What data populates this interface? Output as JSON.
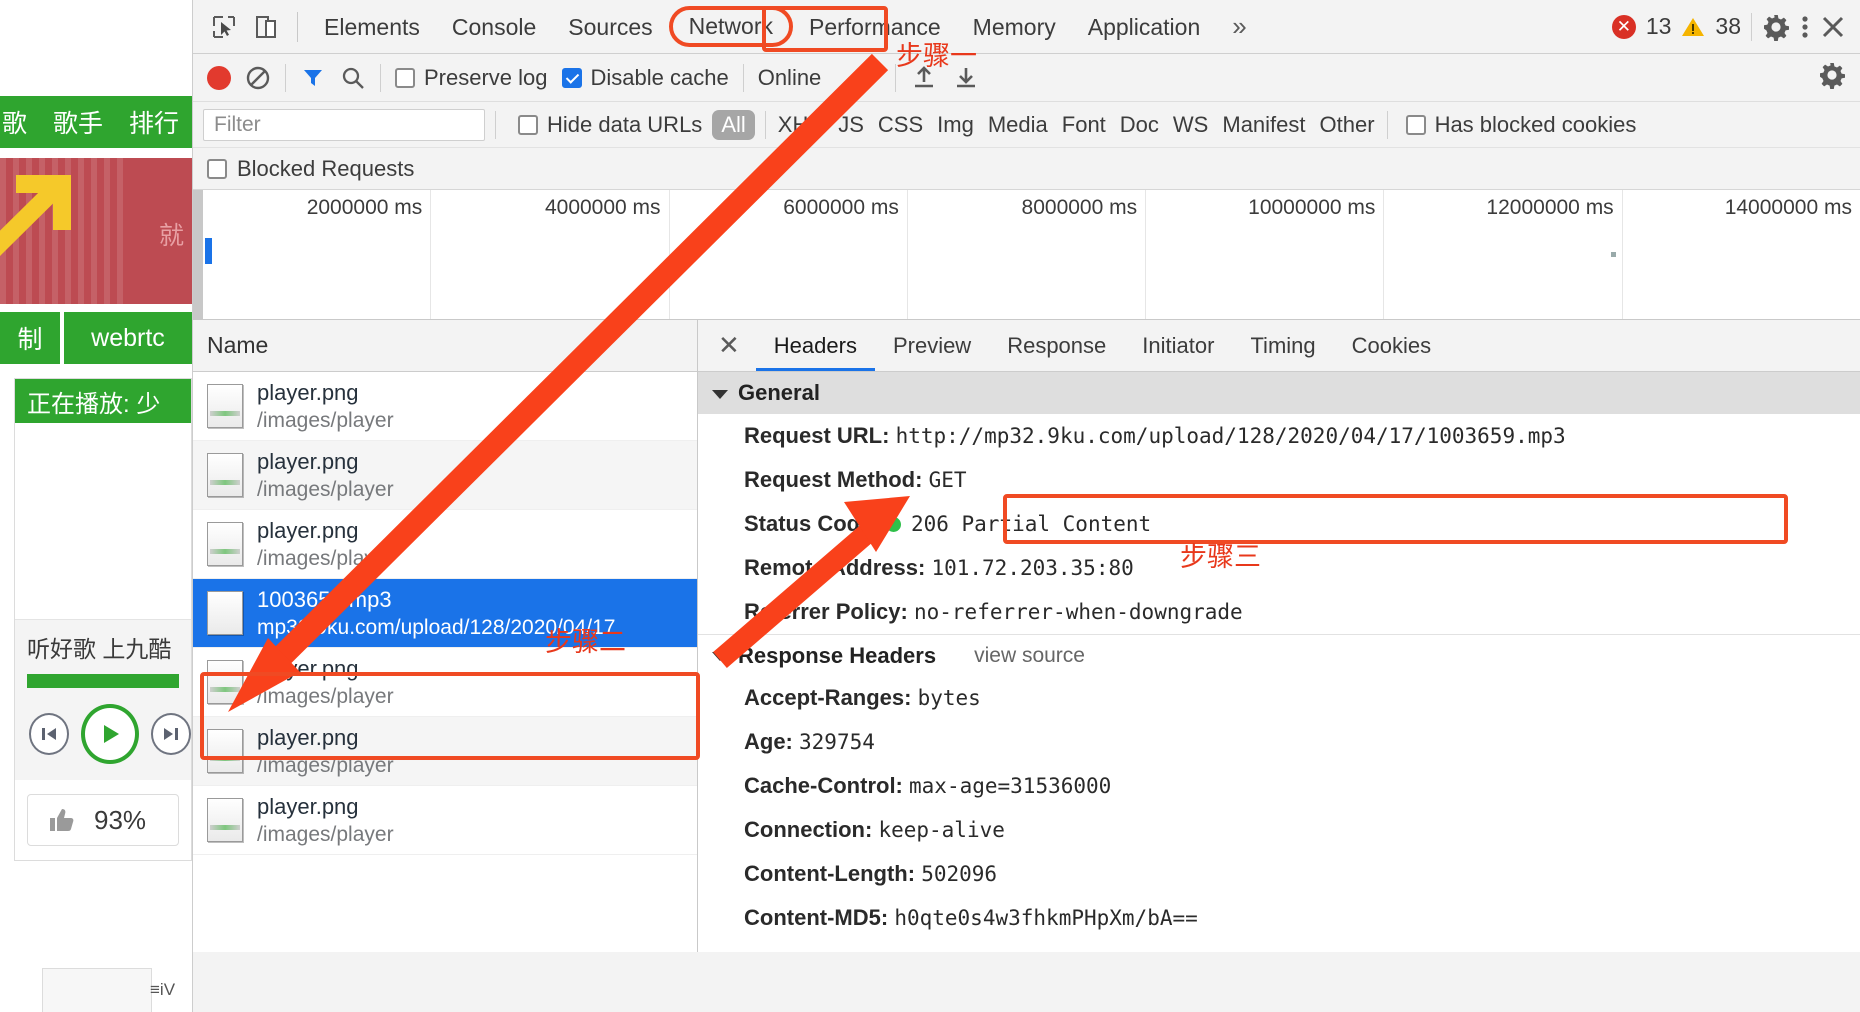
{
  "page": {
    "nav_items": [
      "歌",
      "歌手",
      "排行"
    ],
    "banner_text": "就",
    "tabs": [
      "制",
      "webrtc"
    ],
    "player": {
      "now_playing": "正在播放: 少",
      "footer_text": "听好歌 上九酷",
      "like_percent": "93%",
      "bottom_label": "≡iV"
    }
  },
  "devtools": {
    "tabs": [
      "Elements",
      "Console",
      "Sources",
      "Network",
      "Performance",
      "Memory",
      "Application"
    ],
    "active_tab": "Network",
    "more_label": "»",
    "errors": "13",
    "warnings": "38",
    "icons": {
      "inspect": "inspect-element-icon",
      "device": "device-toolbar-icon",
      "settings": "gear-icon",
      "menu": "kebab-menu-icon",
      "close": "close-icon"
    },
    "toolbar": {
      "record_label": "record-button",
      "clear_label": "clear-button",
      "filter_label": "filter-funnel-icon",
      "search_label": "search-icon",
      "preserve_log": "Preserve log",
      "preserve_log_checked": false,
      "disable_cache": "Disable cache",
      "disable_cache_checked": true,
      "throttling": "Online",
      "import_label": "import-har-icon",
      "export_label": "export-har-icon",
      "settings_label": "network-settings-gear-icon"
    },
    "filterbar": {
      "filter_placeholder": "Filter",
      "hide_data_urls": "Hide data URLs",
      "hide_data_urls_checked": false,
      "types": [
        "All",
        "XHR",
        "JS",
        "CSS",
        "Img",
        "Media",
        "Font",
        "Doc",
        "WS",
        "Manifest",
        "Other"
      ],
      "active_type": "All",
      "has_blocked_cookies": "Has blocked cookies",
      "has_blocked_cookies_checked": false,
      "blocked_requests": "Blocked Requests",
      "blocked_requests_checked": false
    },
    "overview_ticks": [
      "2000000 ms",
      "4000000 ms",
      "6000000 ms",
      "8000000 ms",
      "10000000 ms",
      "12000000 ms",
      "14000000 ms"
    ],
    "requests": {
      "column_header": "Name",
      "rows": [
        {
          "name": "player.png",
          "path": "/images/player",
          "selected": false,
          "thumb": "image-thumbnail"
        },
        {
          "name": "player.png",
          "path": "/images/player",
          "selected": false,
          "thumb": "image-thumbnail"
        },
        {
          "name": "player.png",
          "path": "/images/player",
          "selected": false,
          "thumb": "image-thumbnail"
        },
        {
          "name": "1003659.mp3",
          "path": "mp32.9ku.com/upload/128/2020/04/17",
          "selected": true,
          "thumb": "media-thumbnail"
        },
        {
          "name": "player.png",
          "path": "/images/player",
          "selected": false,
          "thumb": "image-thumbnail"
        },
        {
          "name": "player.png",
          "path": "/images/player",
          "selected": false,
          "thumb": "image-thumbnail"
        },
        {
          "name": "player.png",
          "path": "/images/player",
          "selected": false,
          "thumb": "image-thumbnail"
        }
      ]
    },
    "details": {
      "tabs": [
        "Headers",
        "Preview",
        "Response",
        "Initiator",
        "Timing",
        "Cookies"
      ],
      "active_tab": "Headers",
      "general_title": "General",
      "general": [
        {
          "key": "Request URL:",
          "value": "http://mp32.9ku.com/upload/128/2020/04/17/1003659.mp3"
        },
        {
          "key": "Request Method:",
          "value": "GET"
        },
        {
          "key": "Status Code:",
          "value": "206 Partial Content"
        },
        {
          "key": "Remote Address:",
          "value": "101.72.203.35:80"
        },
        {
          "key": "Referrer Policy:",
          "value": "no-referrer-when-downgrade"
        }
      ],
      "response_headers_title": "Response Headers",
      "view_source": "view source",
      "response_headers": [
        {
          "key": "Accept-Ranges:",
          "value": "bytes"
        },
        {
          "key": "Age:",
          "value": "329754"
        },
        {
          "key": "Cache-Control:",
          "value": "max-age=31536000"
        },
        {
          "key": "Connection:",
          "value": "keep-alive"
        },
        {
          "key": "Content-Length:",
          "value": "502096"
        },
        {
          "key": "Content-MD5:",
          "value": "h0qte0s4w3fhkmPHpXm/bA=="
        }
      ]
    }
  },
  "annotations": {
    "step1": "步骤一",
    "step2": "步骤二",
    "step3": "步骤三",
    "accent": "#f04a23"
  }
}
